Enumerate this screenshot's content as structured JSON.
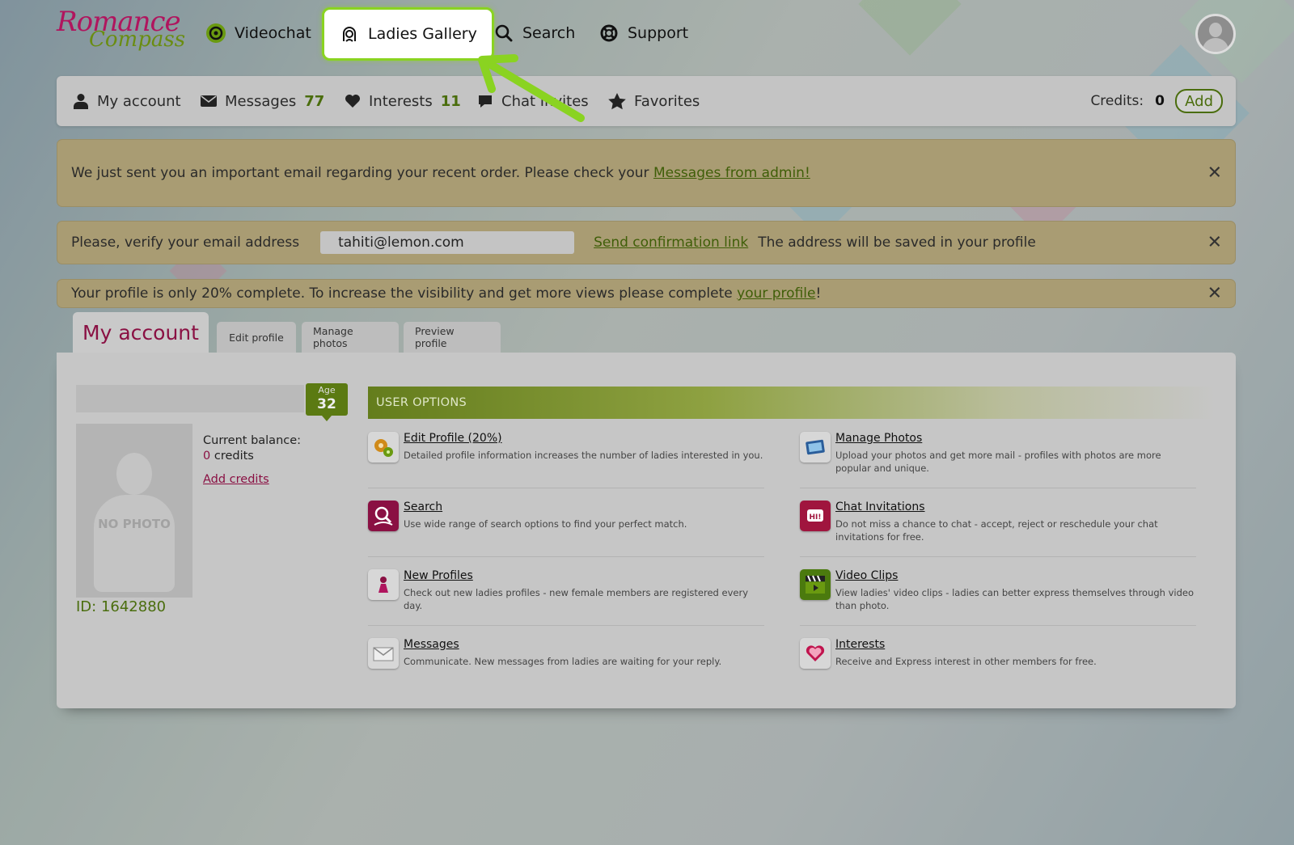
{
  "logo": {
    "line1": "Romance",
    "line2": "Compass"
  },
  "topnav": {
    "videochat": "Videochat",
    "ladies_gallery": "Ladies Gallery",
    "search": "Search",
    "support": "Support"
  },
  "subnav": {
    "my_account": "My account",
    "messages": "Messages",
    "messages_count": "77",
    "interests": "Interests",
    "interests_count": "11",
    "chat_invites": "Chat Invites",
    "favorites": "Favorites",
    "credits_label": "Credits:",
    "credits_value": "0",
    "add_label": "Add"
  },
  "notices": {
    "admin_text": "We just sent you an important email regarding your recent order. Please check your ",
    "admin_link": "Messages from admin!",
    "verify_text": "Please, verify your email address",
    "verify_email": "tahiti@lemon.com",
    "verify_link": "Send confirmation link",
    "verify_after": "The address will be saved in your profile",
    "profile_text": "Your profile is only 20% complete. To increase the visibility and get more views please complete ",
    "profile_link": "your profile",
    "profile_end": "!"
  },
  "tabs": {
    "main": "My account",
    "edit": "Edit profile",
    "photos": "Manage photos",
    "preview": "Preview profile"
  },
  "profile": {
    "age_label": "Age",
    "age_value": "32",
    "no_photo": "NO PHOTO",
    "balance_label": "Current balance:",
    "balance_value": "0",
    "balance_unit": " credits",
    "add_credits": "Add credits",
    "id_label": "ID: 1642880"
  },
  "options": {
    "header": "USER OPTIONS",
    "items": [
      {
        "title": "Edit Profile (20%)",
        "desc": "Detailed profile information increases the number of ladies interested in you."
      },
      {
        "title": "Manage Photos",
        "desc": "Upload your photos and get more mail - profiles with photos are more popular and unique."
      },
      {
        "title": "Search",
        "desc": "Use wide range of search options to find your perfect match."
      },
      {
        "title": "Chat Invitations",
        "desc": "Do not miss a chance to chat - accept, reject or reschedule your chat invitations for free."
      },
      {
        "title": "New Profiles",
        "desc": "Check out new ladies profiles - new female members are registered every day."
      },
      {
        "title": "Video Clips",
        "desc": "View ladies' video clips - ladies can better express themselves through video than photo."
      },
      {
        "title": "Messages",
        "desc": "Communicate. New messages from ladies are waiting for your reply."
      },
      {
        "title": "Interests",
        "desc": "Receive and Express interest in other members for free."
      }
    ]
  },
  "colors": {
    "accent_green": "#8ad321",
    "brand_magenta": "#8a1043",
    "link_green": "#3f5e08"
  }
}
